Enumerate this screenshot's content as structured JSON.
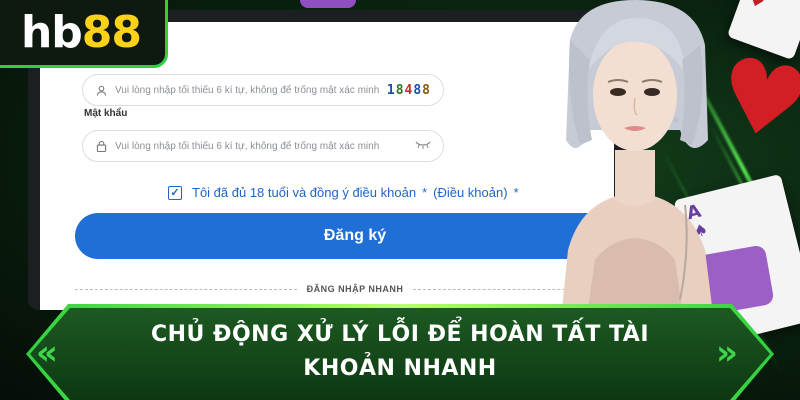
{
  "brand": {
    "logo_text_a": "hb",
    "logo_text_b": "88"
  },
  "form": {
    "field1_placeholder": "Vui lòng nhập tối thiểu 6 kí tự, không để trống mật xác minh",
    "captcha": [
      "1",
      "8",
      "4",
      "8",
      "8"
    ],
    "password_label": "Mật khẩu",
    "field2_placeholder": "Vui lòng nhập tối thiểu 6 kí tự, không để trống mật xác minh",
    "agree_text": "Tôi đã đủ 18 tuổi và đồng ý điều khoản",
    "agree_star": "*",
    "agree_link": "(Điều khoản)",
    "agree_star2": "*",
    "agree_checked": true,
    "register_button": "Đăng ký",
    "quick_login_label": "ĐĂNG NHẬP NHANH"
  },
  "banner": {
    "line1": "CHỦ ĐỘNG XỬ LÝ LỖI ĐỂ HOÀN TẤT TÀI",
    "line2": "KHOẢN NHANH",
    "left_chevrons": "«",
    "right_chevrons": "»"
  },
  "colors": {
    "accent": "#1f6fd6",
    "brand_green": "#2fd040",
    "brand_yellow": "#ffd21a",
    "banner_green": "#1d5a22"
  },
  "icons": [
    "user-icon",
    "lock-icon",
    "eye-closed-icon",
    "checkbox-checked-icon",
    "heart-suit-icon",
    "spade-suit-icon"
  ]
}
